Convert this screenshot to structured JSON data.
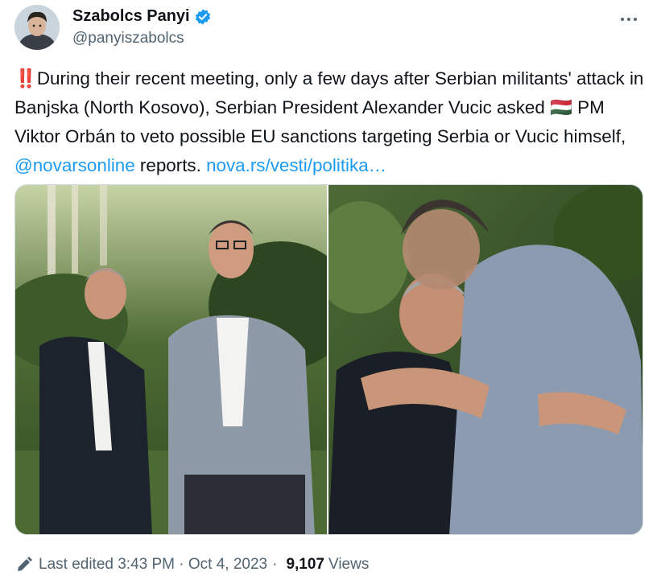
{
  "author": {
    "display_name": "Szabolcs Panyi",
    "handle": "@panyiszabolcs",
    "verified": true,
    "avatar_icon": "avatar-photo"
  },
  "tweet": {
    "emoji_prefix": "‼️",
    "text_part1": "During their recent meeting, only a few days after Serbian militants' attack in Banjska (North Kosovo), Serbian President Alexander Vucic asked ",
    "flag_emoji": "🇭🇺",
    "text_part2": " PM Viktor Orbán to veto possible EU sanctions targeting Serbia or Vucic himself, ",
    "mention": "@novarsonline",
    "text_part3": " reports.  ",
    "link": "nova.rs/vesti/politika…"
  },
  "meta": {
    "edited_label": "Last edited 3:43 PM · Oct 4, 2023",
    "separator": "·",
    "views_count": "9,107",
    "views_label": "Views"
  },
  "colors": {
    "link": "#1d9bf0",
    "secondary_text": "#536471",
    "verified_badge": "#1d9bf0"
  }
}
